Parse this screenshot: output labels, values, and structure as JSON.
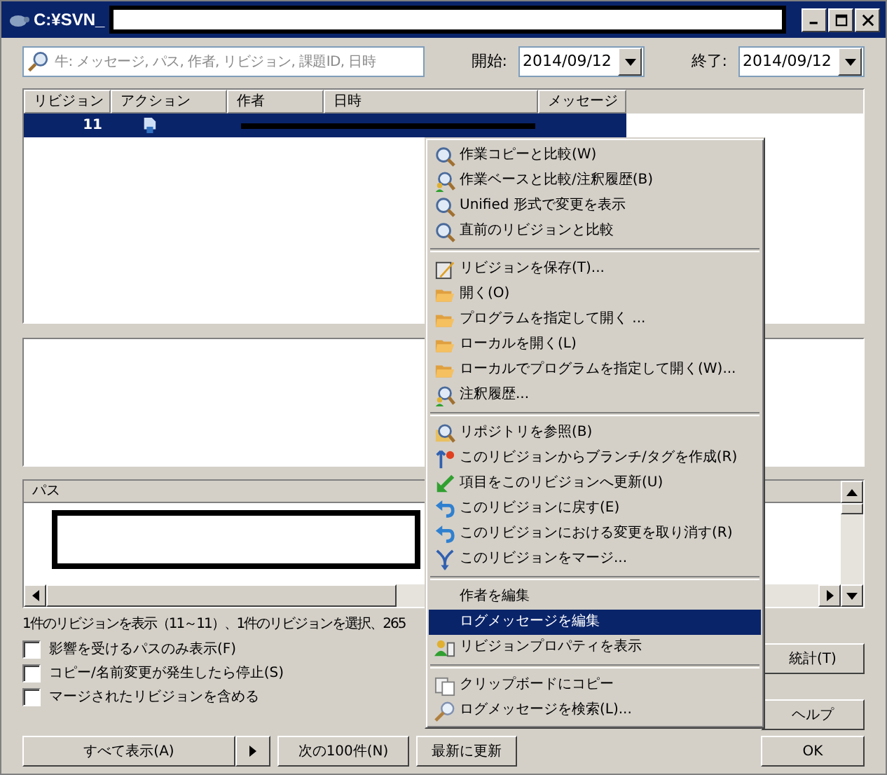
{
  "window": {
    "title": "C:¥SVN_"
  },
  "filter": {
    "placeholder": "牛: メッセージ, パス, 作者, リビジョン, 課題ID, 日時",
    "start_label": "開始:",
    "start_value": "2014/09/12",
    "end_label": "終了:",
    "end_value": "2014/09/12"
  },
  "log_table": {
    "columns": [
      "リビジョン",
      "アクション",
      "作者",
      "日時",
      "メッセージ"
    ],
    "rows": [
      {
        "revision": "11",
        "selected": true
      }
    ]
  },
  "paths_table": {
    "columns": [
      "パス"
    ]
  },
  "status_text": "1件のリビジョンを表示（11～11）、1件のリビジョンを選択、265",
  "options": [
    {
      "label": "影響を受けるパスのみ表示(F)",
      "checked": false
    },
    {
      "label": "コピー/名前変更が発生したら停止(S)",
      "checked": false
    },
    {
      "label": "マージされたリビジョンを含める",
      "checked": false
    }
  ],
  "buttons": {
    "show_all": "すべて表示(A)",
    "next": "次の100件(N)",
    "refresh": "最新に更新",
    "stats": "統計(T)",
    "help": "ヘルプ",
    "ok": "OK"
  },
  "context_menu": [
    [
      {
        "label": "作業コピーと比較(W)",
        "kind": "compare",
        "selected": false
      },
      {
        "label": "作業ベースと比較/注釈履歴(B)",
        "kind": "blame",
        "selected": false
      },
      {
        "label": "Unified 形式で変更を表示",
        "kind": "compare",
        "selected": false
      },
      {
        "label": "直前のリビジョンと比較",
        "kind": "compare",
        "selected": false
      }
    ],
    [
      {
        "label": "リビジョンを保存(T)...",
        "kind": "save",
        "selected": false
      },
      {
        "label": "開く(O)",
        "kind": "folder",
        "selected": false
      },
      {
        "label": "プログラムを指定して開く ...",
        "kind": "folder",
        "selected": false
      },
      {
        "label": "ローカルを開く(L)",
        "kind": "folder",
        "selected": false
      },
      {
        "label": "ローカルでプログラムを指定して開く(W)...",
        "kind": "folder",
        "selected": false
      },
      {
        "label": "注釈履歴...",
        "kind": "blame",
        "selected": false
      }
    ],
    [
      {
        "label": "リポジトリを参照(B)",
        "kind": "browse",
        "selected": false
      },
      {
        "label": "このリビジョンからブランチ/タグを作成(R)",
        "kind": "branch",
        "selected": false
      },
      {
        "label": "項目をこのリビジョンへ更新(U)",
        "kind": "update",
        "selected": false
      },
      {
        "label": "このリビジョンに戻す(E)",
        "kind": "revert",
        "selected": false
      },
      {
        "label": "このリビジョンにおける変更を取り消す(R)",
        "kind": "revert",
        "selected": false
      },
      {
        "label": "このリビジョンをマージ...",
        "kind": "merge",
        "selected": false
      }
    ],
    [
      {
        "label": "作者を編集",
        "kind": "plain",
        "selected": false
      },
      {
        "label": "ログメッセージを編集",
        "kind": "plain",
        "selected": true
      },
      {
        "label": "リビジョンプロパティを表示",
        "kind": "props",
        "selected": false
      }
    ],
    [
      {
        "label": "クリップボードにコピー",
        "kind": "copy",
        "selected": false
      },
      {
        "label": "ログメッセージを検索(L)...",
        "kind": "search",
        "selected": false
      }
    ]
  ]
}
